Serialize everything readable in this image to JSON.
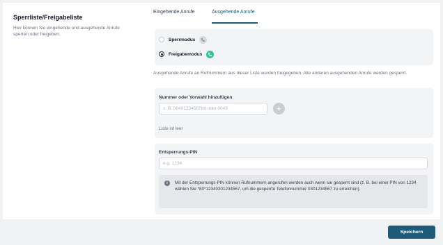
{
  "section": {
    "title": "Sperrliste/Freigabeliste",
    "description": "Hier können Sie eingehende und ausgehende Anrufe sperren oder freigeben."
  },
  "tabs": [
    {
      "label": "Eingehende Anrufe",
      "active": false
    },
    {
      "label": "Ausgehende Anrufe",
      "active": true
    }
  ],
  "modes": [
    {
      "label": "Sperrmodus",
      "selected": false,
      "icon": "block-phone-icon"
    },
    {
      "label": "Freigabemodus",
      "selected": true,
      "icon": "allow-phone-icon"
    }
  ],
  "mode_info": "Ausgehende Anrufe an Rufnummern aus dieser Liste werden freigegeben. Alle anderen ausgehenden Anrufe werden gesperrt.",
  "add_number": {
    "label": "Nummer oder Vorwahl hinzufügen",
    "placeholder": "z. B. 0043123456789 oder 0043",
    "value": "",
    "empty_text": "Liste ist leer"
  },
  "pin": {
    "label": "Entsperrungs-PIN",
    "placeholder": "e.g. 1234",
    "value": "",
    "notice": "Mit der Entsperrungs-PIN können Rufnummern angerufen werden auch wenn sie gesperrt sind (z. B. bei einer PIN von 1234 wählen Sie *80*12340301234567, um die gesperrte Telefonnummer 0301234567 zu erreichen)."
  },
  "save_label": "Speichern",
  "colors": {
    "accent": "#1c5a78",
    "active_mode": "#34c39a",
    "background": "#f1f2f4"
  }
}
